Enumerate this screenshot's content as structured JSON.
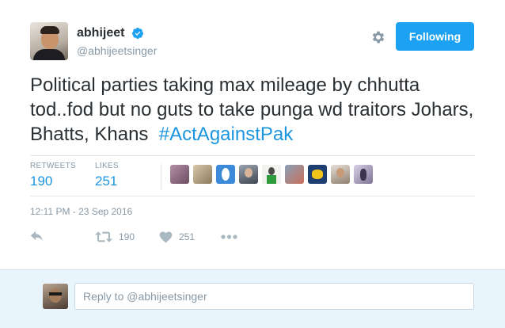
{
  "author": {
    "name": "abhijeet",
    "handle": "@abhijeetsinger",
    "verified": true
  },
  "follow_button": {
    "label": "Following"
  },
  "tweet": {
    "text_before": "Political parties taking max mileage by chhutta tod..fod but no guts to take punga wd traitors Johars, Bhatts, Khans",
    "hashtag": "#ActAgainstPak"
  },
  "stats": {
    "retweets_label": "RETWEETS",
    "retweets_value": "190",
    "likes_label": "LIKES",
    "likes_value": "251"
  },
  "likers_count_shown": 9,
  "timestamp": "12:11 PM - 23 Sep 2016",
  "actions": {
    "retweet_count": "190",
    "like_count": "251"
  },
  "reply": {
    "placeholder": "Reply to @abhijeetsinger"
  },
  "colors": {
    "accent": "#1da1f2",
    "link": "#1b95e0",
    "muted": "#8899a6",
    "reply_bg": "#e8f5fd"
  }
}
